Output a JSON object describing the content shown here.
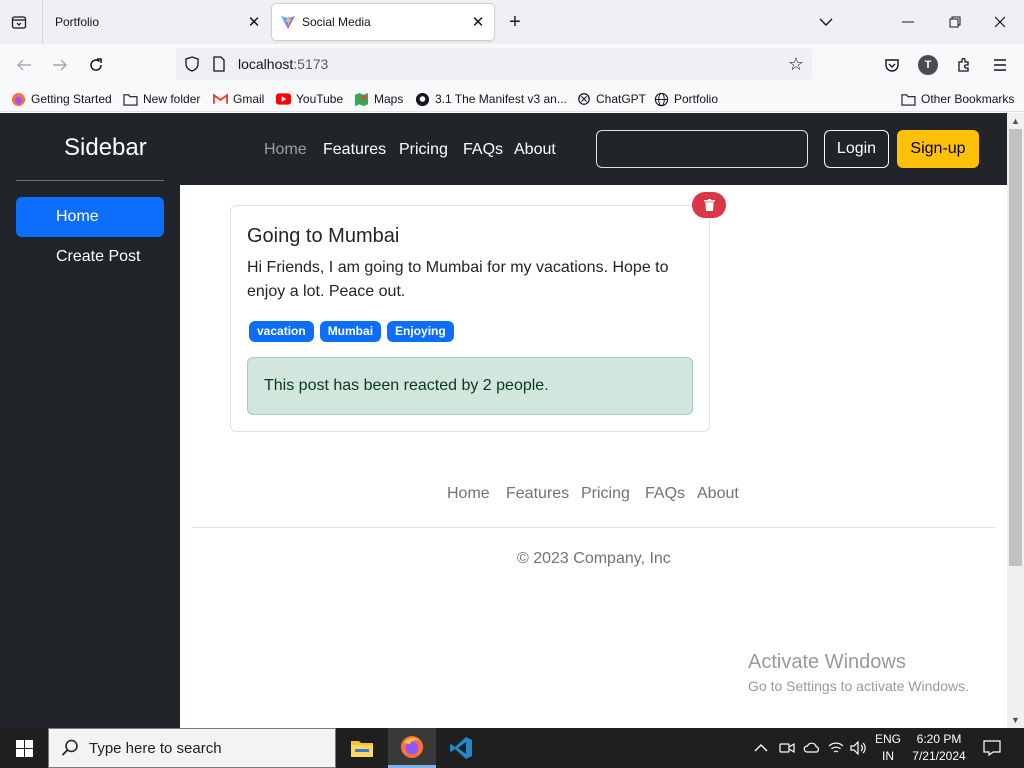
{
  "browser": {
    "tabs": [
      {
        "title": "Portfolio",
        "active": false
      },
      {
        "title": "Social Media",
        "active": true
      }
    ],
    "url": {
      "host": "localhost",
      "port": ":5173"
    },
    "bookmarks": [
      "Getting Started",
      "New folder",
      "Gmail",
      "YouTube",
      "Maps",
      "3.1 The Manifest v3 an...",
      "ChatGPT",
      "Portfolio"
    ],
    "other_bookmarks": "Other Bookmarks",
    "profile_initial": "T"
  },
  "sidebar": {
    "brand": "Sidebar",
    "items": [
      {
        "label": "Home",
        "active": true
      },
      {
        "label": "Create Post",
        "active": false
      }
    ]
  },
  "header": {
    "nav": [
      "Home",
      "Features",
      "Pricing",
      "FAQs",
      "About"
    ],
    "search_value": "",
    "login": "Login",
    "signup": "Sign-up"
  },
  "post": {
    "title": "Going to Mumbai",
    "body": "Hi Friends, I am going to Mumbai for my vacations. Hope to enjoy a lot. Peace out.",
    "tags": [
      "vacation",
      "Mumbai",
      "Enjoying"
    ],
    "reactions_text": "This post has been reacted by 2 people."
  },
  "footer": {
    "nav": [
      "Home",
      "Features",
      "Pricing",
      "FAQs",
      "About"
    ],
    "copyright": "© 2023 Company, Inc"
  },
  "watermark": {
    "line1": "Activate Windows",
    "line2": "Go to Settings to activate Windows."
  },
  "taskbar": {
    "search_placeholder": "Type here to search",
    "lang_line1": "ENG",
    "lang_line2": "IN",
    "time": "6:20 PM",
    "date": "7/21/2024"
  },
  "colors": {
    "primary": "#0d6efd",
    "danger": "#dc3545",
    "warning": "#ffc107",
    "dark": "#212529",
    "success_bg": "#d1e7dd"
  }
}
